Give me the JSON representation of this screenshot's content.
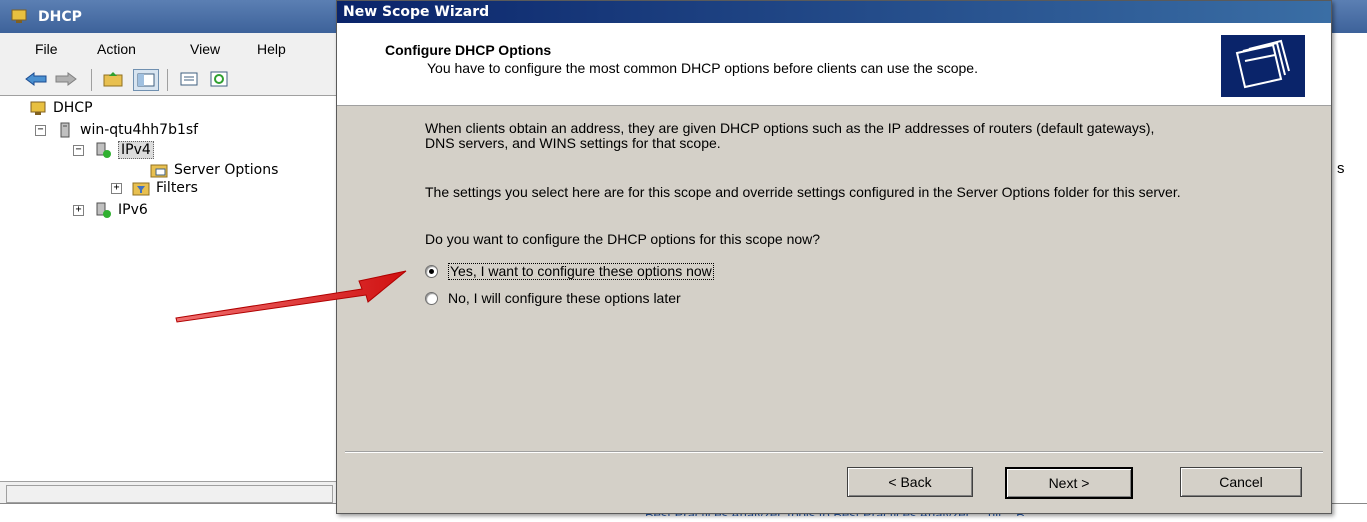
{
  "mmc": {
    "title": "DHCP",
    "menu": [
      "File",
      "Action",
      "View",
      "Help"
    ],
    "tree": {
      "root": "DHCP",
      "server": "win-qtu4hh7b1sf",
      "ipv4": "IPv4",
      "server_options": "Server Options",
      "filters": "Filters",
      "ipv6": "IPv6"
    },
    "right_fragment": "s",
    "bottom_link": "Best Practices Analyzer  Tools to Best Practices Analyzer ... ult... B"
  },
  "wizard": {
    "title": "New Scope Wizard",
    "heading": "Configure DHCP Options",
    "subtext": "You have to configure the most common DHCP options before clients can use the scope.",
    "para1": "When clients obtain an address, they are given DHCP options such as the IP addresses of routers (default gateways), DNS servers, and WINS settings for that scope.",
    "para2": "The settings you select here are for this scope and override settings configured in the Server Options folder for this server.",
    "question": "Do you want to configure the DHCP options for this scope now?",
    "option_yes": "Yes, I want to configure these options now",
    "option_no": "No, I will configure these options later",
    "back": "< Back",
    "next": "Next >",
    "cancel": "Cancel"
  },
  "colors": {
    "wizard_title_bg": "#0a246a",
    "dialog_face": "#d4d0c8",
    "annotation_arrow": "#e02020"
  }
}
